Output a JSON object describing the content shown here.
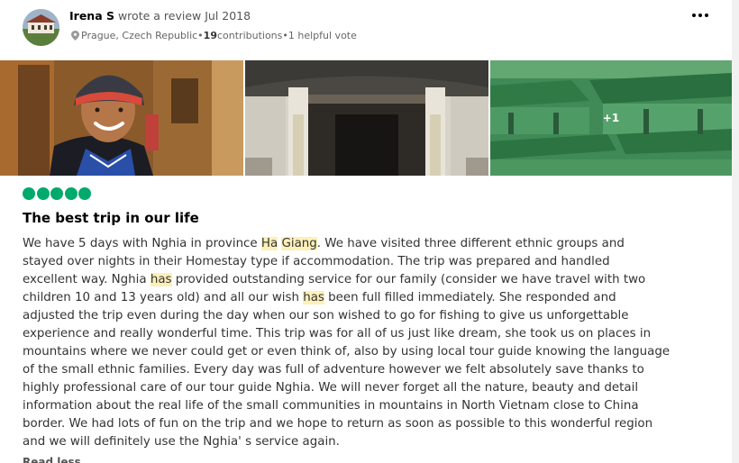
{
  "reviewer": {
    "name": "Irena S",
    "action": " wrote a review ",
    "date": "Jul 2018",
    "location": "Prague, Czech Republic",
    "contributions_count": "19",
    "contributions_label": " contributions",
    "dot": " • ",
    "helpful": "1 helpful vote"
  },
  "photos": {
    "more_count": "+1"
  },
  "rating": {
    "bubbles": 5,
    "max": 5,
    "color": "#00aa6c"
  },
  "review": {
    "title": "The best trip in our life",
    "lines": [
      [
        "We have 5 days with Nghia in province ",
        {
          "hl": "Ha"
        },
        " ",
        {
          "hl": "Giang"
        },
        ". We have visited three different ethnic groups and"
      ],
      [
        "stayed over nights in their Homestay type if accommodation. The trip was prepared and handled"
      ],
      [
        "excellent way. Nghia ",
        {
          "hl": "has"
        },
        " provided outstanding service for our family (consider we have travel with two"
      ],
      [
        "children 10 and 13 years old) and all our wish ",
        {
          "hl": "has"
        },
        " been full filled immediately. She responded and"
      ],
      [
        "adjusted the trip even during the day when our son wished to go for fishing to give us unforgettable"
      ],
      [
        "experience and really wonderful time. This trip was for all of us just like dream, she took us on places in"
      ],
      [
        "mountains where we never could get or even think of, also by using local tour guide knowing the language"
      ],
      [
        "of the small ethnic families. Every day was full of adventure however we felt absolutely save thanks to"
      ],
      [
        "highly professional care of our tour guide Nghia. We will never forget all the nature, beauty and detail"
      ],
      [
        "information about the real life of the small communities in mountains in North Vietnam close to China"
      ],
      [
        "border. We had lots of fun on the trip and we hope to return as soon as possible to this wonderful region"
      ],
      [
        "and we will definitely use the Nghia' s service again."
      ]
    ],
    "highlight_color": "#fdf0b8"
  },
  "read_more": "Read less"
}
